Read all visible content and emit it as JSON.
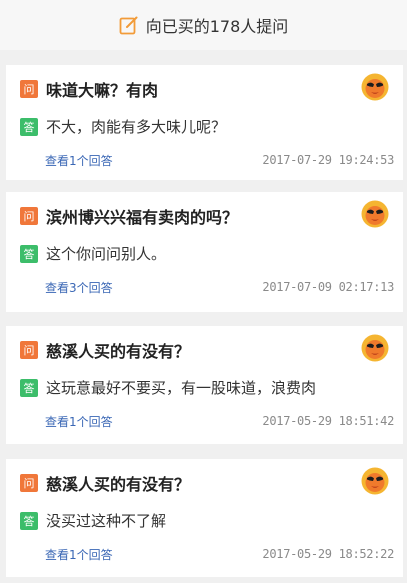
{
  "header": {
    "title": "向已买的178人提问"
  },
  "badges": {
    "question": "问",
    "answer": "答"
  },
  "questions": [
    {
      "question": "味道大嘛？有肉",
      "answer": "不大，肉能有多大味儿呢？",
      "more_link": "查看1个回答",
      "timestamp": "2017-07-29 19:24:53"
    },
    {
      "question": "滨州博兴兴福有卖肉的吗？",
      "answer": "这个你问问别人。",
      "more_link": "查看3个回答",
      "timestamp": "2017-07-09 02:17:13"
    },
    {
      "question": "慈溪人买的有没有？",
      "answer": "这玩意最好不要买，有一股味道，浪费肉",
      "more_link": "查看1个回答",
      "timestamp": "2017-05-29 18:51:42"
    },
    {
      "question": "慈溪人买的有没有？",
      "answer": "没买过这种不了解",
      "more_link": "查看1个回答",
      "timestamp": "2017-05-29 18:52:22"
    }
  ],
  "colors": {
    "question_badge": "#f0773a",
    "answer_badge": "#3cbd6a",
    "link": "#3a67b5",
    "header_icon": "#f29b38"
  }
}
